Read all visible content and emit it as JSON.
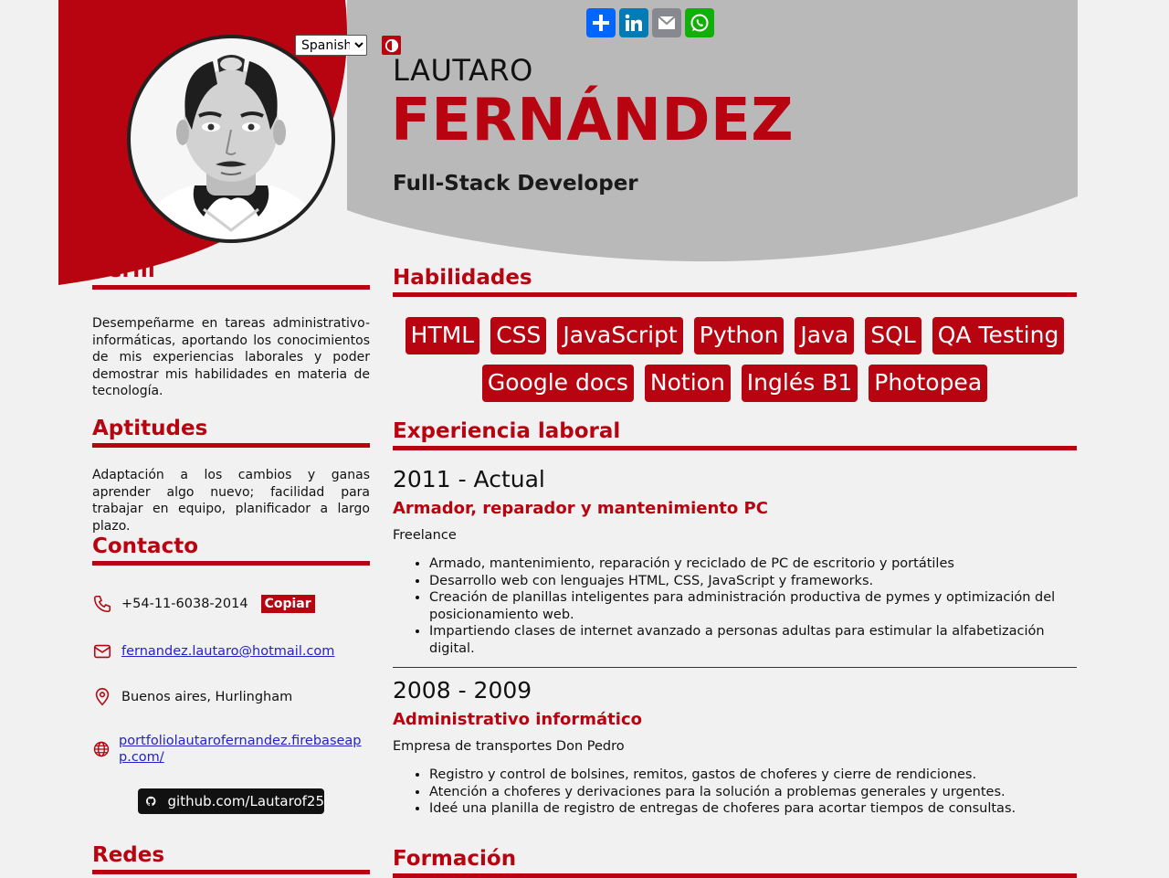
{
  "share": {
    "buttons": [
      {
        "name": "addtoany-icon",
        "color": "#0166ff"
      },
      {
        "name": "linkedin-icon",
        "color": "#007bb5"
      },
      {
        "name": "email-icon",
        "color": "#888990"
      },
      {
        "name": "whatsapp-icon",
        "color": "#12af0a"
      }
    ]
  },
  "language": {
    "selected": "Spanish"
  },
  "profile": {
    "first_name": "LAUTARO",
    "last_name": "FERNÁNDEZ",
    "role": "Full-Stack Developer"
  },
  "colors": {
    "accent": "#b70410",
    "header_gray": "#b9b9b9",
    "background": "#f1f1f1"
  },
  "perfil": {
    "title": "Perfil",
    "text": "Desempeñarme en tareas administrativo-informáticas, aportando los conocimientos de mis experiencias laborales y poder demostrar mis habilidades en materia de tecnología."
  },
  "aptitudes": {
    "title": "Aptitudes",
    "text": "Adaptación a los cambios y ganas aprender algo nuevo; facilidad para trabajar en equipo, planificador a largo plazo."
  },
  "contacto": {
    "title": "Contacto",
    "phone": "+54-11-6038-2014",
    "copy_label": "Copiar",
    "email": "fernandez.lautaro@hotmail.com",
    "location": "Buenos aires, Hurlingham",
    "website": "portfoliolautarofernandez.firebaseapp.com/",
    "github": "github.com/Lautarof25"
  },
  "redes": {
    "title": "Redes"
  },
  "habilidades": {
    "title": "Habilidades",
    "skills": [
      "HTML",
      "CSS",
      "JavaScript",
      "Python",
      "Java",
      "SQL",
      "QA Testing",
      "Google docs",
      "Notion",
      "Inglés B1",
      "Photopea"
    ]
  },
  "experiencia": {
    "title": "Experiencia laboral",
    "jobs": [
      {
        "period": "2011 - Actual",
        "title": "Armador, reparador y mantenimiento PC",
        "company": "Freelance",
        "items": [
          "Armado, mantenimiento, reparación y reciclado de PC de escritorio y portátiles",
          "Desarrollo web con lenguajes HTML, CSS, JavaScript y frameworks.",
          "Creación de planillas inteligentes para administración productiva de pymes y optimización del posicionamiento web.",
          "Impartiendo clases de internet avanzado a personas adultas para estimular la alfabetización digital."
        ]
      },
      {
        "period": "2008 - 2009",
        "title": "Administrativo informático",
        "company": "Empresa de transportes Don Pedro",
        "items": [
          "Registro y control de bolsines, remitos, gastos de choferes y cierre de rendiciones.",
          "Atención a choferes y derivaciones para la solución a problemas generales y urgentes.",
          "Ideé una planilla de registro de entregas de choferes para acortar tiempos de consultas."
        ]
      }
    ]
  },
  "formacion": {
    "title": "Formación"
  }
}
